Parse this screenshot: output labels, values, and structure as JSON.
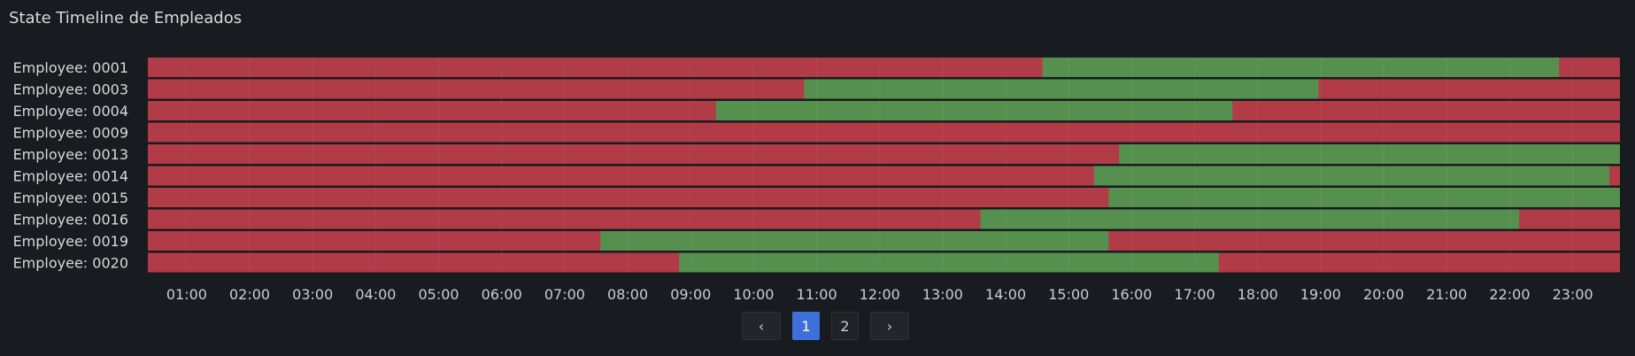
{
  "panel": {
    "title": "State Timeline de Empleados"
  },
  "pagination": {
    "prev_icon": "‹",
    "next_icon": "›",
    "pages": [
      "1",
      "2"
    ],
    "current": "1"
  },
  "colors": {
    "absent": "#b13b47",
    "present": "#56904f",
    "background": "#181b1f",
    "grid": "#2a2d31"
  },
  "chart_data": {
    "type": "state-timeline",
    "title": "State Timeline de Empleados",
    "x_ticks": [
      "01:00",
      "02:00",
      "03:00",
      "04:00",
      "05:00",
      "06:00",
      "07:00",
      "08:00",
      "09:00",
      "10:00",
      "11:00",
      "12:00",
      "13:00",
      "14:00",
      "15:00",
      "16:00",
      "17:00",
      "18:00",
      "19:00",
      "20:00",
      "21:00",
      "22:00",
      "23:00"
    ],
    "x_range": [
      "00:23",
      "23:45"
    ],
    "series": [
      {
        "name": "Employee: 0001",
        "green": [
          [
            "14:35",
            "22:47"
          ]
        ]
      },
      {
        "name": "Employee: 0003",
        "green": [
          [
            "10:48",
            "18:58"
          ]
        ]
      },
      {
        "name": "Employee: 0004",
        "green": [
          [
            "09:24",
            "17:36"
          ]
        ]
      },
      {
        "name": "Employee: 0009",
        "green": []
      },
      {
        "name": "Employee: 0013",
        "green": [
          [
            "15:48",
            "23:45"
          ]
        ]
      },
      {
        "name": "Employee: 0014",
        "green": [
          [
            "15:24",
            "23:35"
          ]
        ]
      },
      {
        "name": "Employee: 0015",
        "green": [
          [
            "15:38",
            "23:45"
          ]
        ]
      },
      {
        "name": "Employee: 0016",
        "green": [
          [
            "13:36",
            "22:09"
          ]
        ]
      },
      {
        "name": "Employee: 0019",
        "green": [
          [
            "07:34",
            "15:38"
          ]
        ]
      },
      {
        "name": "Employee: 0020",
        "green": [
          [
            "08:49",
            "17:23"
          ]
        ]
      }
    ]
  }
}
